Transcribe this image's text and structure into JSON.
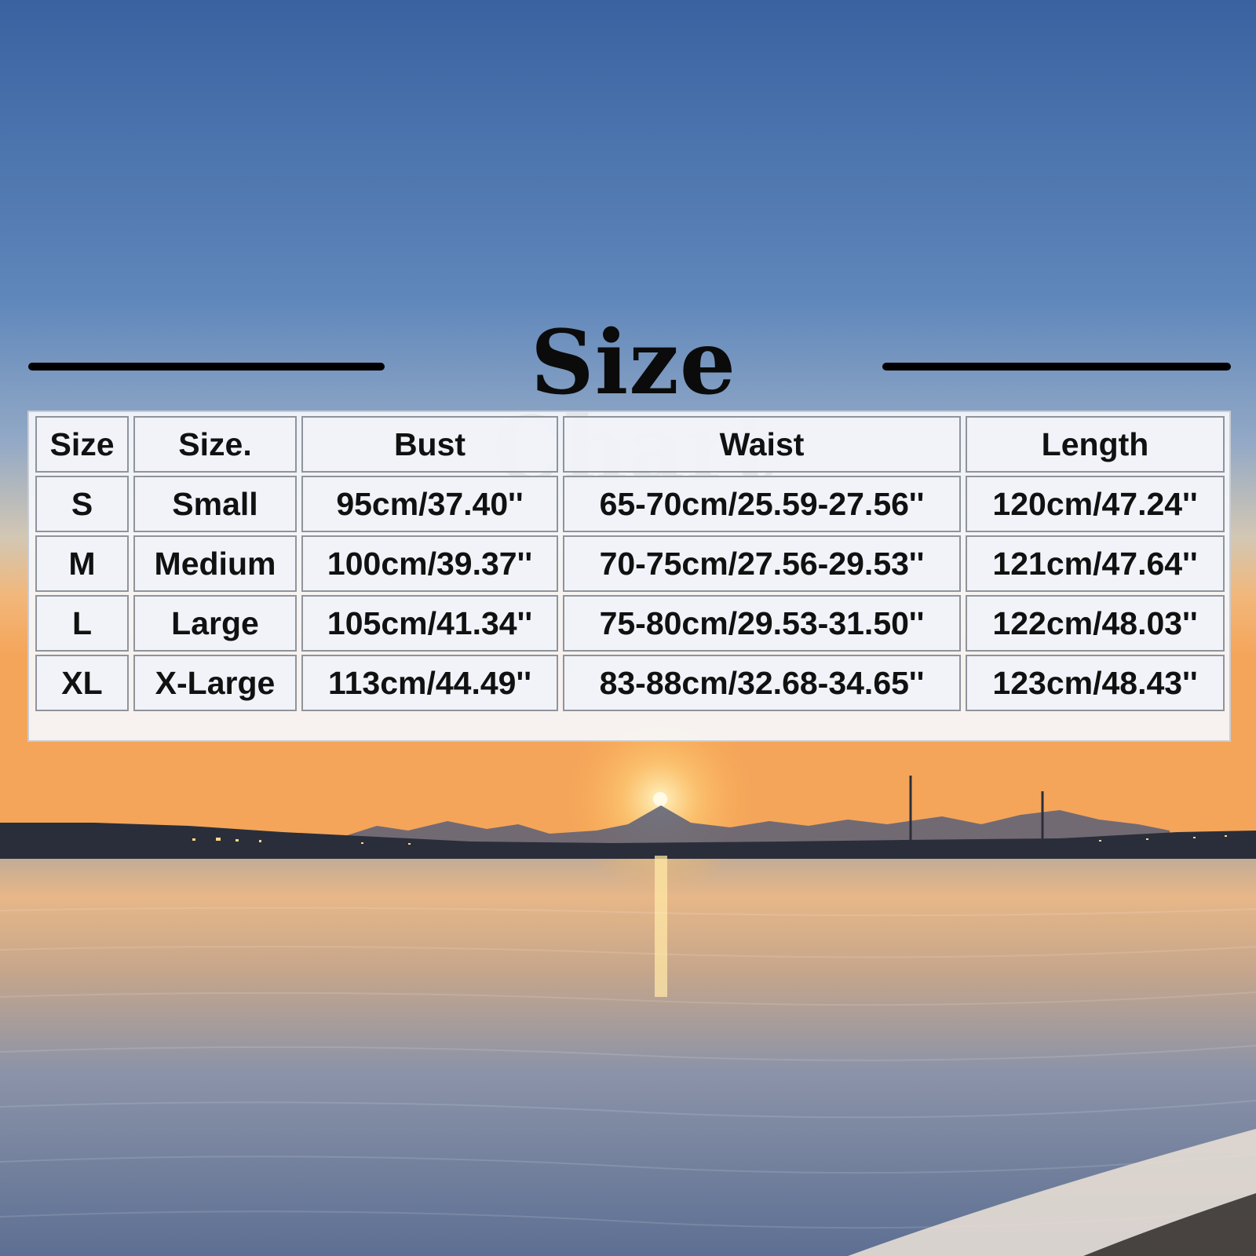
{
  "title": "Size Chart",
  "table": {
    "headers": [
      "Size",
      "Size.",
      "Bust",
      "Waist",
      "Length"
    ],
    "rows": [
      [
        "S",
        "Small",
        "95cm/37.40''",
        "65-70cm/25.59-27.56''",
        "120cm/47.24''"
      ],
      [
        "M",
        "Medium",
        "100cm/39.37''",
        "70-75cm/27.56-29.53''",
        "121cm/47.64''"
      ],
      [
        "L",
        "Large",
        "105cm/41.34''",
        "75-80cm/29.53-31.50''",
        "122cm/48.03''"
      ],
      [
        "XL",
        "X-Large",
        "113cm/44.49''",
        "83-88cm/32.68-34.65''",
        "123cm/48.43''"
      ]
    ]
  }
}
